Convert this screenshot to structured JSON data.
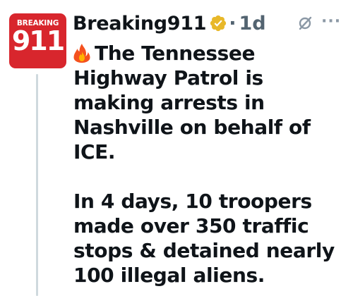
{
  "post": {
    "avatar": {
      "logo_top": "BREAKING",
      "logo_number": "911",
      "color": "#d8262d"
    },
    "author": {
      "display_name": "Breaking911",
      "verified_badge": "gold-verified-check-icon"
    },
    "separator": "·",
    "timestamp": "1d",
    "icons": {
      "grok": "grok-slash-circle-icon",
      "more": "more-horizontal-icon",
      "more_glyph": "···",
      "fire": "fire-emoji-icon"
    },
    "paragraphs": [
      "The Tennessee Highway Patrol is making arrests in Nashville on behalf of ICE.",
      "In 4 days, 10 troopers made over 350 traffic stops & detained nearly 100 illegal aliens."
    ]
  }
}
